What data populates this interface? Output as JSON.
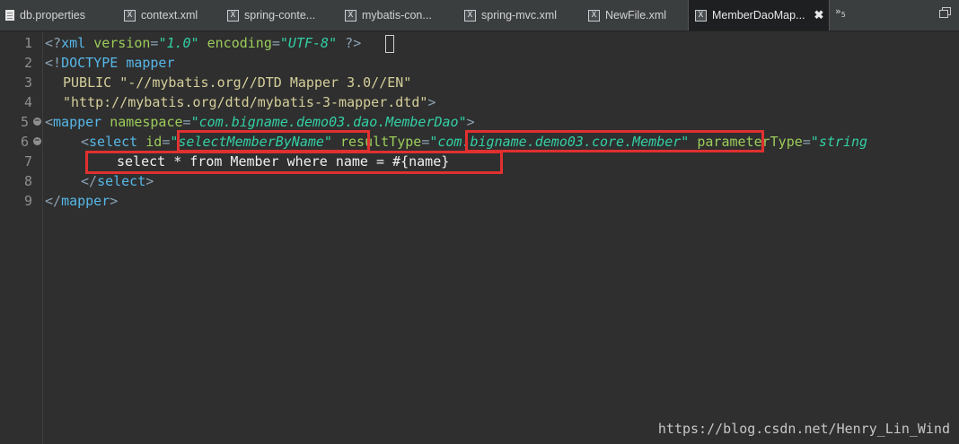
{
  "tabs": [
    {
      "label": "db.properties",
      "icon": "properties-file-icon"
    },
    {
      "label": "context.xml",
      "icon": "xml-file-icon"
    },
    {
      "label": "spring-conte...",
      "icon": "xml-file-icon"
    },
    {
      "label": "mybatis-con...",
      "icon": "xml-file-icon"
    },
    {
      "label": "spring-mvc.xml",
      "icon": "xml-file-icon"
    },
    {
      "label": "NewFile.xml",
      "icon": "xml-file-icon"
    },
    {
      "label": "MemberDaoMap...",
      "icon": "xml-file-icon",
      "active": true,
      "close": "✖"
    }
  ],
  "tab_overflow": {
    "label": "»",
    "count": "5"
  },
  "editor": {
    "line_numbers": [
      "1",
      "2",
      "3",
      "4",
      "5",
      "6",
      "7",
      "8",
      "9"
    ],
    "lines": {
      "l1": {
        "open": "<?",
        "tag": "xml",
        "attr1": "version",
        "eq1": "=",
        "val1": "\"1.0\"",
        "attr2": "encoding",
        "eq2": "=",
        "val2": "\"UTF-8\"",
        "close_q": "?",
        "close": ">"
      },
      "l2": {
        "open": "<!",
        "tag": "DOCTYPE",
        "name": "mapper"
      },
      "l3": {
        "text": "PUBLIC \"-//mybatis.org//DTD Mapper 3.0//EN\""
      },
      "l4": {
        "text": "\"http://mybatis.org/dtd/mybatis-3-mapper.dtd\"",
        "close": ">"
      },
      "l5": {
        "open": "<",
        "tag": "mapper",
        "attr": "namespace",
        "eq": "=",
        "val": "\"com.bigname.demo03.dao.MemberDao\"",
        "close": ">"
      },
      "l6": {
        "open": "<",
        "tag": "select",
        "attr1": "id",
        "eq1": "=",
        "val1": "\"selectMemberByName\"",
        "attr2": "resultType",
        "eq2": "=",
        "val2": "\"com.bigname.demo03.core.Member\"",
        "attr3": "parameterType",
        "eq3": "=",
        "val3": "\"string"
      },
      "l7": {
        "text": "select * from Member where name = #{name}"
      },
      "l8": {
        "open": "</",
        "tag": "select",
        "close": ">"
      },
      "l9": {
        "open": "</",
        "tag": "mapper",
        "close": ">"
      }
    }
  },
  "watermark": "https://blog.csdn.net/Henry_Lin_Wind",
  "colors": {
    "highlight_box": "#e03030",
    "tag": "#56b7e8",
    "string": "#33cfa4"
  }
}
